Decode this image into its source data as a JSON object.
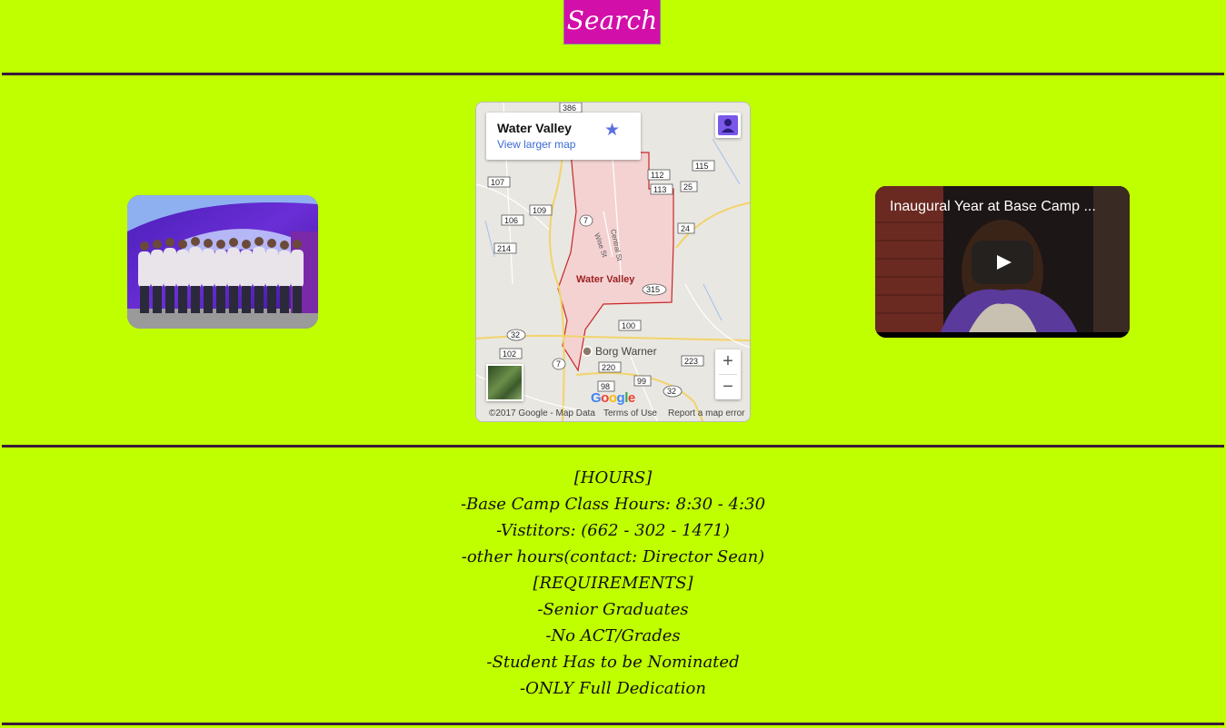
{
  "search": {
    "label": "Search"
  },
  "map": {
    "place_name": "Water Valley",
    "larger_map_link": "View larger map",
    "town_label": "Water Valley",
    "poi_label": "Borg Warner",
    "streets": [
      "Central St",
      "Wise St"
    ],
    "route_shields": [
      "386",
      "107",
      "109",
      "106",
      "7",
      "112",
      "113",
      "115",
      "25",
      "24",
      "214",
      "315",
      "32",
      "100",
      "102",
      "7",
      "220",
      "223",
      "99",
      "98",
      "32"
    ],
    "zoom_in": "+",
    "zoom_out": "−",
    "google_logo": "Google",
    "copyright": "©2017 Google - Map Data",
    "terms": "Terms of Use",
    "report": "Report a map error"
  },
  "video": {
    "title": "Inaugural Year at Base Camp ..."
  },
  "info": {
    "lines": [
      "[HOURS]",
      "-Base Camp Class Hours: 8:30 - 4:30",
      "-Vistitors: (662 - 302 - 1471)",
      "-other hours(contact: Director Sean)",
      "[REQUIREMENTS]",
      "-Senior Graduates",
      "-No ACT/Grades",
      "-Student Has to be Nominated",
      "-ONLY Full Dedication"
    ]
  },
  "colors": {
    "background": "#c0ff00",
    "button": "#d20fa8",
    "rule": "#3a1a3a",
    "map_boundary": "#c62828"
  }
}
